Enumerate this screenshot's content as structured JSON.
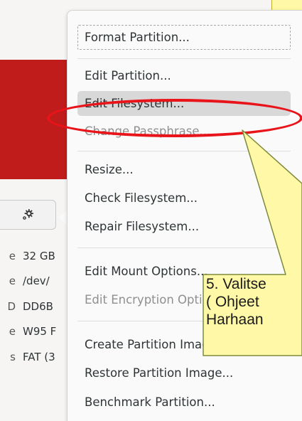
{
  "background": {
    "accent_color": "#c01c1c",
    "settings_icon": "gear-icon",
    "info_rows": [
      {
        "key": "e",
        "value": "32 GB"
      },
      {
        "key": "e",
        "value": "/dev/"
      },
      {
        "key": "D",
        "value": "DD6B"
      },
      {
        "key": "e",
        "value": "W95 F"
      },
      {
        "key": "s",
        "value": "FAT (3"
      }
    ]
  },
  "menu": {
    "items": [
      {
        "label": "Format Partition...",
        "enabled": true,
        "focused": true
      },
      {
        "label": "Edit Partition...",
        "enabled": true
      },
      {
        "label": "Edit Filesystem...",
        "enabled": true,
        "highlighted": true
      },
      {
        "label": "Change Passphrase...",
        "enabled": false
      },
      {
        "label": "Resize...",
        "enabled": true
      },
      {
        "label": "Check Filesystem...",
        "enabled": true
      },
      {
        "label": "Repair Filesystem...",
        "enabled": true
      },
      {
        "label": "Edit Mount Options...",
        "enabled": true
      },
      {
        "label": "Edit Encryption Options...",
        "enabled": false
      },
      {
        "label": "Create Partition Image...",
        "enabled": true
      },
      {
        "label": "Restore Partition Image...",
        "enabled": true
      },
      {
        "label": "Benchmark Partition...",
        "enabled": true
      }
    ]
  },
  "annotation": {
    "highlight_color": "#e8141a",
    "callout_color": "#fff8a6",
    "callout_lines": [
      "5. Valitse",
      "( Ohjeet",
      "Harhaan"
    ]
  }
}
